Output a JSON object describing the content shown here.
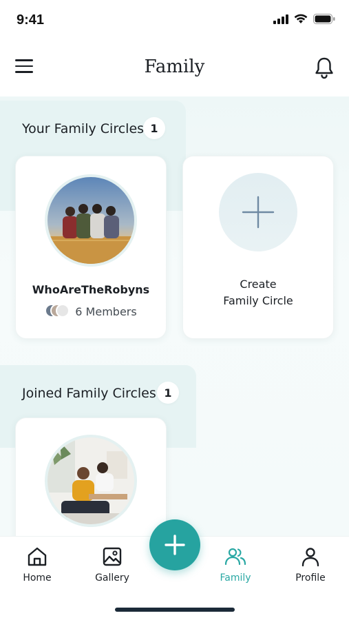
{
  "status_bar": {
    "time": "9:41"
  },
  "header": {
    "title": "Family"
  },
  "your_circles": {
    "title": "Your Family Circles",
    "count": "1",
    "items": [
      {
        "name": "WhoAreTheRobyns",
        "members": "6 Members"
      }
    ],
    "create_card": {
      "line1": "Create",
      "line2": "Family Circle"
    }
  },
  "joined_circles": {
    "title": "Joined Family Circles",
    "count": "1"
  },
  "bottom_nav": {
    "items": [
      {
        "label": "Home",
        "icon": "home-icon"
      },
      {
        "label": "Gallery",
        "icon": "gallery-icon"
      },
      {
        "label": "Family",
        "icon": "family-icon",
        "active": true
      },
      {
        "label": "Profile",
        "icon": "profile-icon"
      }
    ],
    "fab_icon": "plus-icon"
  },
  "colors": {
    "accent": "#26a3a0",
    "active_label": "#2aa8a4",
    "section_bg": "#e6f3f3",
    "text": "#1b1f24"
  }
}
